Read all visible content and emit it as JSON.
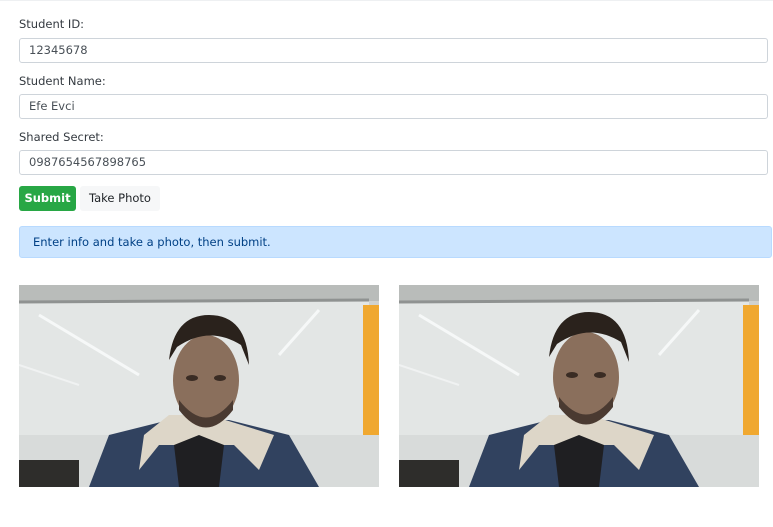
{
  "form": {
    "student_id": {
      "label": "Student ID:",
      "value": "12345678"
    },
    "student_name": {
      "label": "Student Name:",
      "value": "Efe Evci"
    },
    "shared_secret": {
      "label": "Shared Secret:",
      "value": "0987654567898765"
    }
  },
  "buttons": {
    "submit_label": "Submit",
    "take_photo_label": "Take Photo"
  },
  "alert": {
    "message": "Enter info and take a photo, then submit."
  },
  "colors": {
    "submit": "#28a745",
    "alert_bg": "#cce5ff",
    "alert_text": "#004085"
  }
}
